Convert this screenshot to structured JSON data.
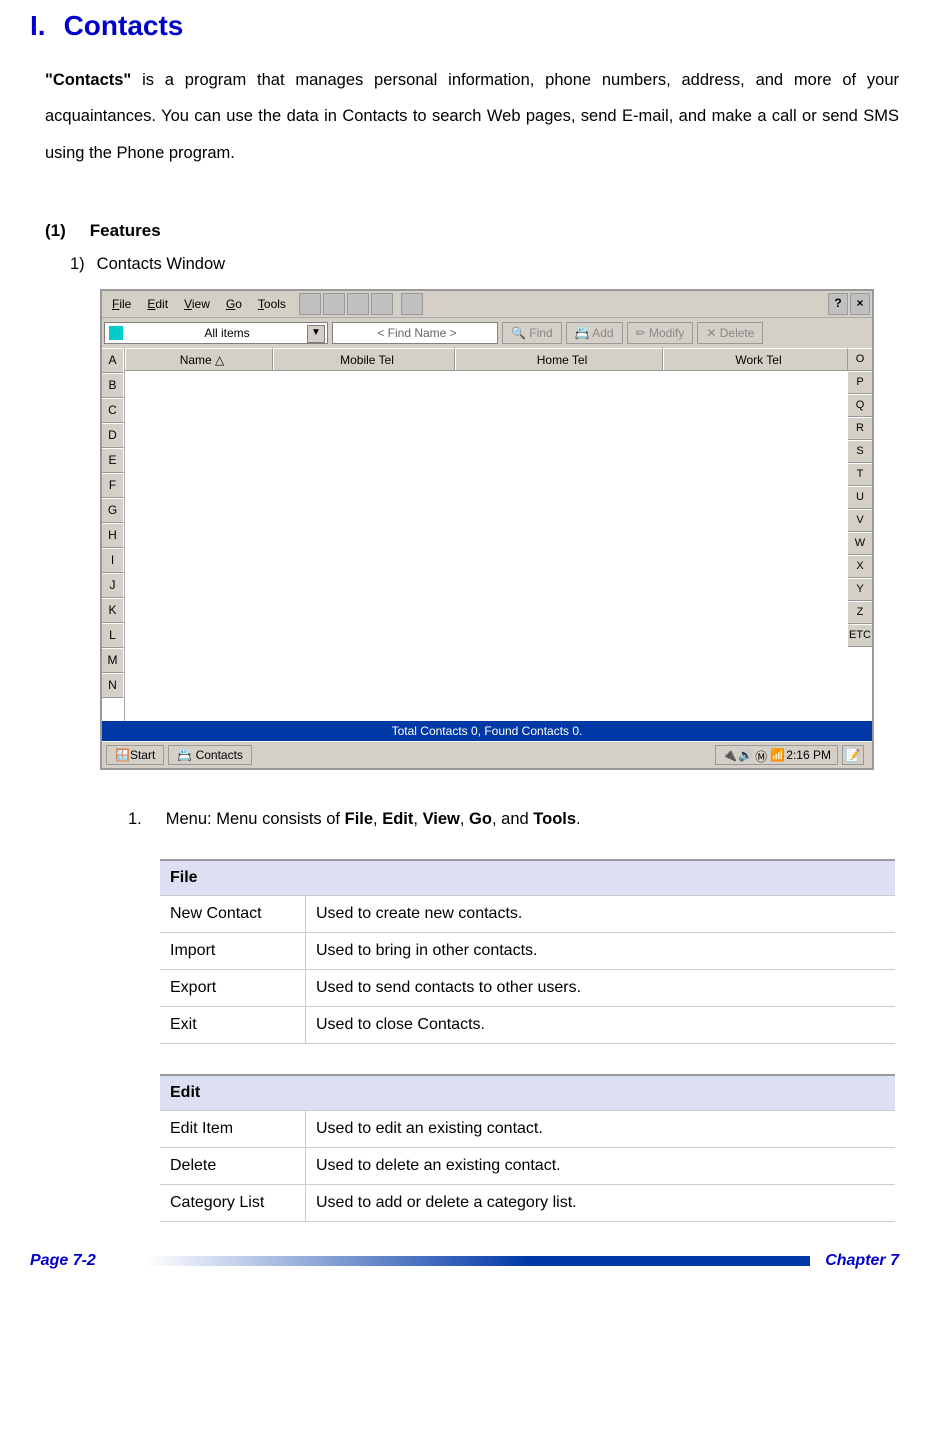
{
  "title": {
    "number": "I.",
    "text": "Contacts"
  },
  "description": {
    "bold": "\"Contacts\"",
    "text": " is a program that manages personal information, phone numbers, address, and more of your acquaintances. You can use the data in Contacts to search Web pages, send E-mail, and make a call or send SMS using the Phone program."
  },
  "subsection": {
    "num": "(1)",
    "text": "Features"
  },
  "item": {
    "num": "1)",
    "text": "Contacts Window"
  },
  "screenshot": {
    "menu": {
      "file": "File",
      "edit": "Edit",
      "view": "View",
      "go": "Go",
      "tools": "Tools",
      "help": "?",
      "close": "×"
    },
    "toolbar": {
      "filter": "All items",
      "search": "< Find  Name >",
      "find": "Find",
      "add": "Add",
      "modify": "Modify",
      "delete": "Delete"
    },
    "columns": {
      "name": "Name",
      "mobile": "Mobile Tel",
      "home": "Home Tel",
      "work": "Work Tel"
    },
    "leftLetters": [
      "A",
      "B",
      "C",
      "D",
      "E",
      "F",
      "G",
      "H",
      "I",
      "J",
      "K",
      "L",
      "M",
      "N"
    ],
    "rightLetters": [
      "O",
      "P",
      "Q",
      "R",
      "S",
      "T",
      "U",
      "V",
      "W",
      "X",
      "Y",
      "Z",
      "ETC"
    ],
    "status": "Total Contacts  0, Found Contacts 0.",
    "taskbar": {
      "start": "Start",
      "app": "Contacts",
      "time": "2:16 PM"
    }
  },
  "numbered": {
    "num": "1.",
    "text_a": "Menu: Menu consists of ",
    "b1": "File",
    "c1": ", ",
    "b2": "Edit",
    "c2": ", ",
    "b3": "View",
    "c3": ", ",
    "b4": "Go",
    "c4": ", and ",
    "b5": "Tools",
    "c5": "."
  },
  "fileTable": {
    "header": "File",
    "rows": [
      {
        "k": "New Contact",
        "v": "Used to create new contacts."
      },
      {
        "k": "Import",
        "v": "Used to bring in other contacts."
      },
      {
        "k": "Export",
        "v": "Used to send contacts to other users."
      },
      {
        "k": "Exit",
        "v": "Used to close Contacts."
      }
    ]
  },
  "editTable": {
    "header": "Edit",
    "rows": [
      {
        "k": "Edit Item",
        "v": "Used to edit an existing contact."
      },
      {
        "k": "Delete",
        "v": "Used to delete an existing contact."
      },
      {
        "k": "Category List",
        "v": "Used to add or delete a category list."
      }
    ]
  },
  "footer": {
    "left": "Page 7-2",
    "right": "Chapter 7"
  }
}
